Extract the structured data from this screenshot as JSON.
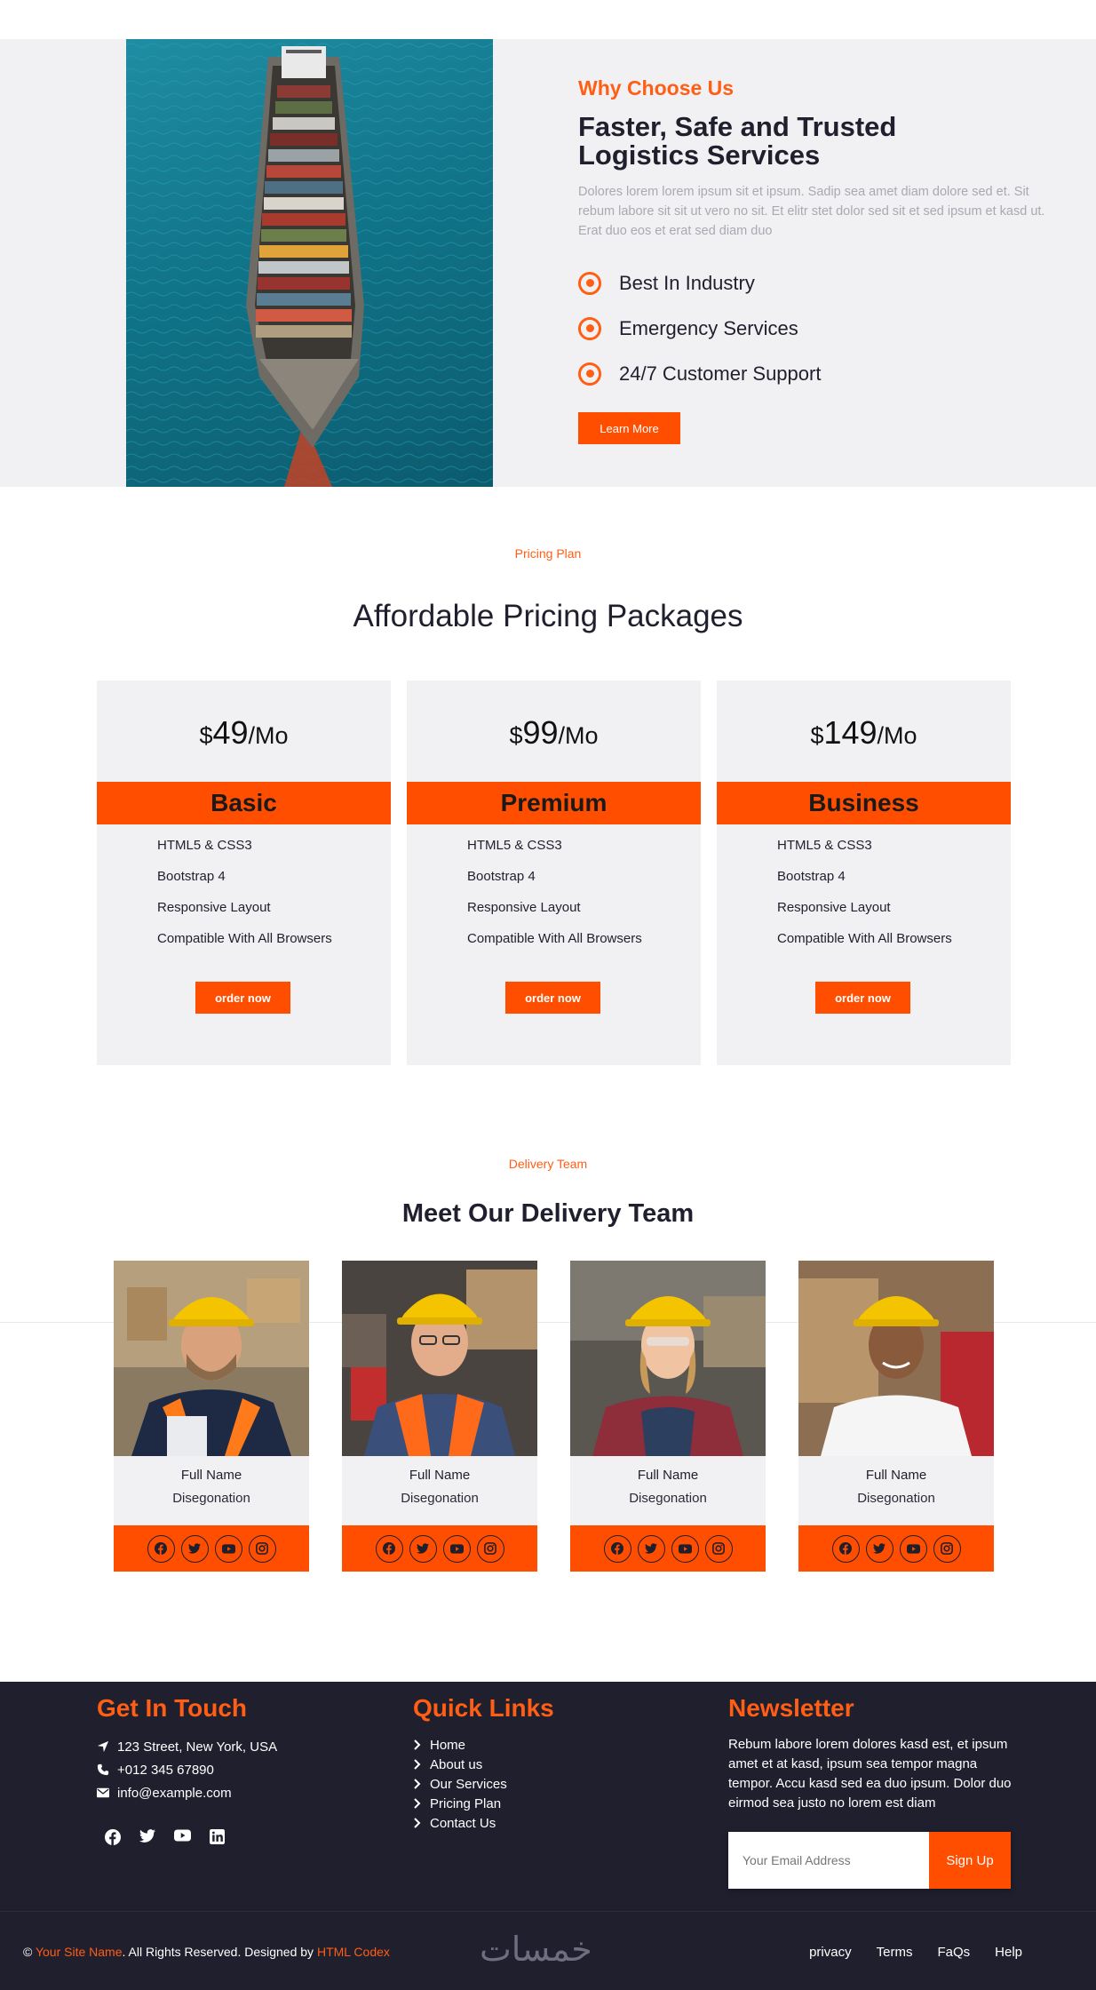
{
  "why": {
    "kicker": "Why Choose Us",
    "title": "Faster, Safe and Trusted Logistics Services",
    "text": "Dolores lorem lorem ipsum sit et ipsum. Sadip sea amet diam dolore sed et. Sit rebum labore sit sit ut vero no sit. Et elitr stet dolor sed sit et sed ipsum et kasd ut. Erat duo eos et erat sed diam duo",
    "features": [
      "Best In Industry",
      "Emergency Services",
      "24/7 Customer Support"
    ],
    "button": "Learn More"
  },
  "pricing": {
    "kicker": "Pricing Plan",
    "title": "Affordable Pricing Packages",
    "plans": [
      {
        "currency": "$",
        "price": "49",
        "period": "/Mo",
        "name": "Basic",
        "features": [
          "HTML5 & CSS3",
          "Bootstrap 4",
          "Responsive Layout",
          "Compatible With All Browsers"
        ],
        "button": "order now"
      },
      {
        "currency": "$",
        "price": "99",
        "period": "/Mo",
        "name": "Premium",
        "features": [
          "HTML5 & CSS3",
          "Bootstrap 4",
          "Responsive Layout",
          "Compatible With All Browsers"
        ],
        "button": "order now"
      },
      {
        "currency": "$",
        "price": "149",
        "period": "/Mo",
        "name": "Business",
        "features": [
          "HTML5 & CSS3",
          "Bootstrap 4",
          "Responsive Layout",
          "Compatible With All Browsers"
        ],
        "button": "order now"
      }
    ]
  },
  "team": {
    "kicker": "Delivery Team",
    "title": "Meet Our Delivery Team",
    "members": [
      {
        "name": "Full Name",
        "designation": "Disegonation"
      },
      {
        "name": "Full Name",
        "designation": "Disegonation"
      },
      {
        "name": "Full Name",
        "designation": "Disegonation"
      },
      {
        "name": "Full Name",
        "designation": "Disegonation"
      }
    ],
    "social_icons": [
      "facebook-icon",
      "twitter-icon",
      "youtube-icon",
      "instagram-icon"
    ]
  },
  "footer": {
    "contact": {
      "heading": "Get In Touch",
      "address": "123 Street, New York, USA",
      "phone": "+012 345 67890",
      "email": "info@example.com"
    },
    "quick_links": {
      "heading": "Quick Links",
      "links": [
        "Home",
        "About us",
        "Our Services",
        "Pricing Plan",
        "Contact Us"
      ]
    },
    "newsletter": {
      "heading": "Newsletter",
      "text": "Rebum labore lorem dolores kasd est, et ipsum amet et at kasd, ipsum sea tempor magna tempor. Accu kasd sed ea duo ipsum. Dolor duo eirmod sea justo no lorem est diam",
      "placeholder": "Your Email Address",
      "button": "Sign Up"
    },
    "copyright": {
      "prefix": "© ",
      "site_name": "Your Site Name",
      "middle": ". All Rights Reserved. Designed by ",
      "designer": "HTML Codex"
    },
    "watermark": "خمسات",
    "bottom_links": [
      "privacy",
      "Terms",
      "FaQs",
      "Help"
    ]
  },
  "colors": {
    "accent": "#ff4e00",
    "kicker": "#ff5e14",
    "dark": "#1f1f2e",
    "light_bg": "#f1f1f3"
  }
}
